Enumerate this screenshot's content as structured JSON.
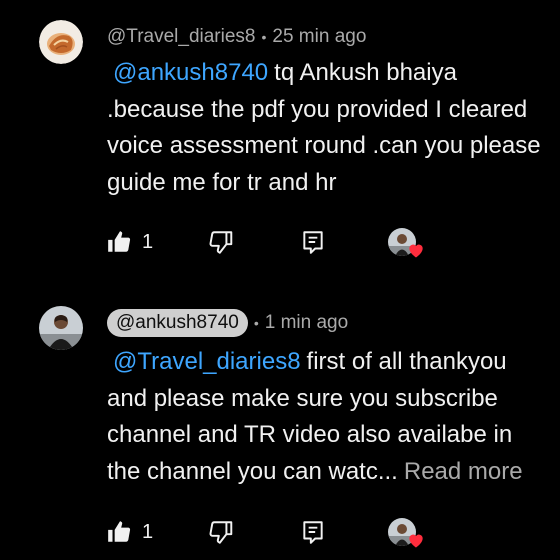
{
  "comments": [
    {
      "author": "@Travel_diaries8",
      "separator": "•",
      "time": "25 min ago",
      "mention": "@ankush8740",
      "text": "tq Ankush bhaiya .because the pdf you provided I cleared voice assessment round  .can you please guide me for tr and hr",
      "likes": "1",
      "avatar_icon": "travel-avatar",
      "hearted": true
    },
    {
      "author": "@ankush8740",
      "separator": "•",
      "time": "1 min ago",
      "mention": "@Travel_diaries8",
      "text": "first of all thankyou and please make sure you subscribe channel and TR video also availabe in the channel you can watc...",
      "read_more": "Read more",
      "likes": "1",
      "avatar_icon": "creator-avatar",
      "hearted": true
    }
  ],
  "colors": {
    "background": "#000000",
    "text": "#f1f1f1",
    "secondary": "#aaaaaa",
    "mention": "#3ea6ff",
    "heart": "#ff2d3d",
    "creator_pill": "#cfcfcf"
  }
}
